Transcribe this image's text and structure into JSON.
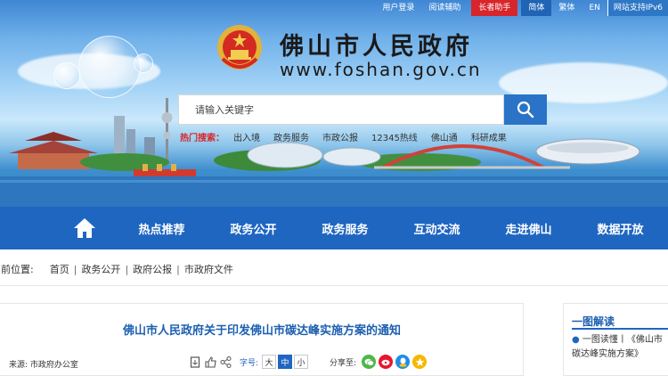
{
  "top_links": [
    "用户登录",
    "阅读辅助",
    "长者助手",
    "简体",
    "繁体",
    "EN",
    "网站支持IPv6"
  ],
  "site": {
    "title": "佛山市人民政府",
    "url": "www.foshan.gov.cn"
  },
  "search": {
    "placeholder": "请输入关键字"
  },
  "hot_search": {
    "label": "热门搜索：",
    "items": [
      "出入境",
      "政务服务",
      "市政公报",
      "12345热线",
      "佛山通",
      "科研成果"
    ]
  },
  "nav": {
    "items": [
      "热点推荐",
      "政务公开",
      "政务服务",
      "互动交流",
      "走进佛山",
      "数据开放"
    ]
  },
  "breadcrumb": {
    "prefix": "当前位置:",
    "items": [
      "首页",
      "政务公开",
      "政府公报",
      "市政府文件"
    ],
    "separator": "|"
  },
  "article": {
    "title": "佛山市人民政府关于印发佛山市碳达峰实施方案的通知",
    "source": "来源:  市政府办公室",
    "font_label": "字号:",
    "font_sizes": [
      "大",
      "中",
      "小"
    ],
    "share_label": "分享至:"
  },
  "side": {
    "title": "一图解读",
    "item_text": "一图读懂丨《佛山市碳达峰实施方案》"
  },
  "colors": {
    "nav": "#1f66c1",
    "title_blue": "#1d5fb0",
    "elder_red": "#d8252b"
  }
}
